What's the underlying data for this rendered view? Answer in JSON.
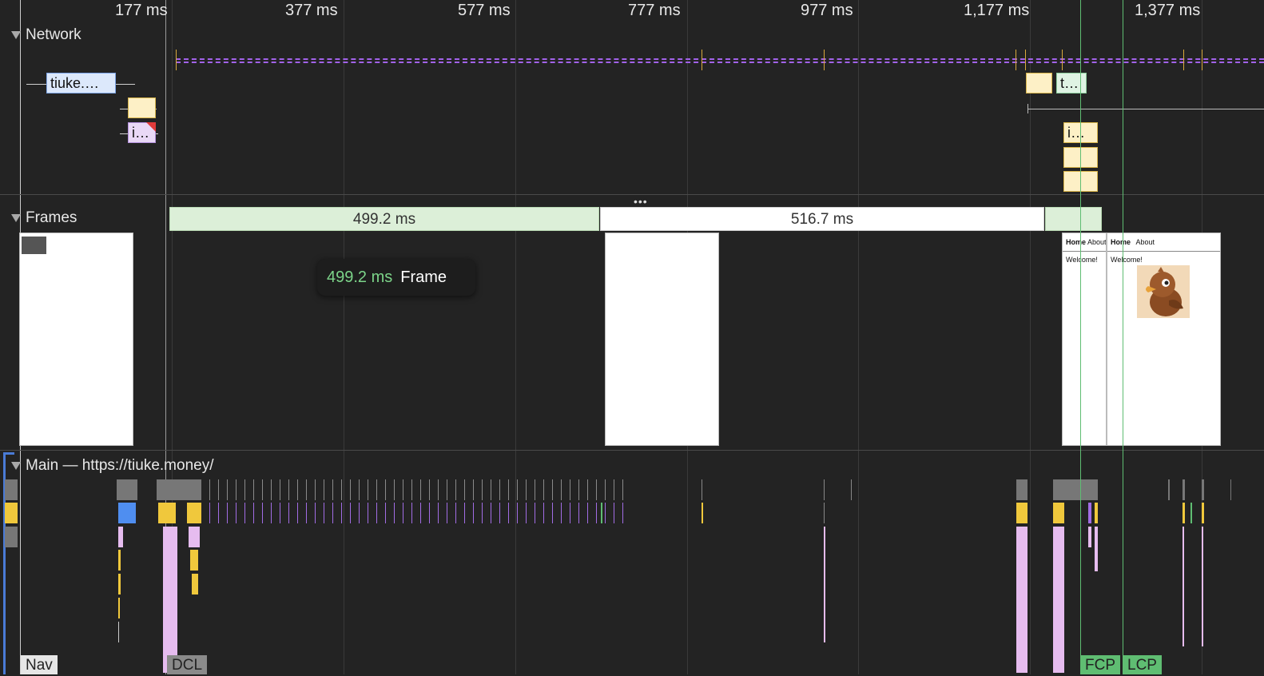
{
  "ruler": {
    "labels": [
      "177 ms",
      "377 ms",
      "577 ms",
      "777 ms",
      "977 ms",
      "1,177 ms",
      "1,377 ms"
    ]
  },
  "tracks": {
    "network": {
      "title": "Network"
    },
    "frames": {
      "title": "Frames"
    },
    "main": {
      "title": "Main — https://tiuke.money/"
    }
  },
  "network": {
    "requests": [
      {
        "label": "tiuke.…",
        "color": "#dce8fb"
      },
      {
        "label": "",
        "color": "#fdf0c6"
      },
      {
        "label": "i…",
        "color": "#e9d8f6"
      },
      {
        "label": "",
        "color": "#fdf0c6"
      },
      {
        "label": "t…",
        "color": "#dff3e3"
      },
      {
        "label": "i…",
        "color": "#fdf0c6"
      }
    ]
  },
  "frames": {
    "blocks": [
      {
        "label": "499.2 ms"
      },
      {
        "label": "516.7 ms"
      }
    ],
    "screenshots": [
      {
        "nav_home": "Home",
        "nav_about": "About",
        "body": "Welcome!"
      },
      {
        "nav_home": "Home",
        "nav_about": "About",
        "body": "Welcome!"
      }
    ]
  },
  "tooltip": {
    "duration": "499.2 ms",
    "label": "Frame"
  },
  "markers": {
    "nav": "Nav",
    "dcl": "DCL",
    "fcp": "FCP",
    "lcp": "LCP"
  },
  "colors": {
    "background": "#232323",
    "frame_idle": "#dcefd8",
    "frame_white": "#ffffff",
    "scripting": "#f0c83c",
    "rendering": "#a26de5",
    "painting": "#e6bcef",
    "fcp_lcp": "#5fbd72",
    "tooltip_value": "#7cd489"
  }
}
